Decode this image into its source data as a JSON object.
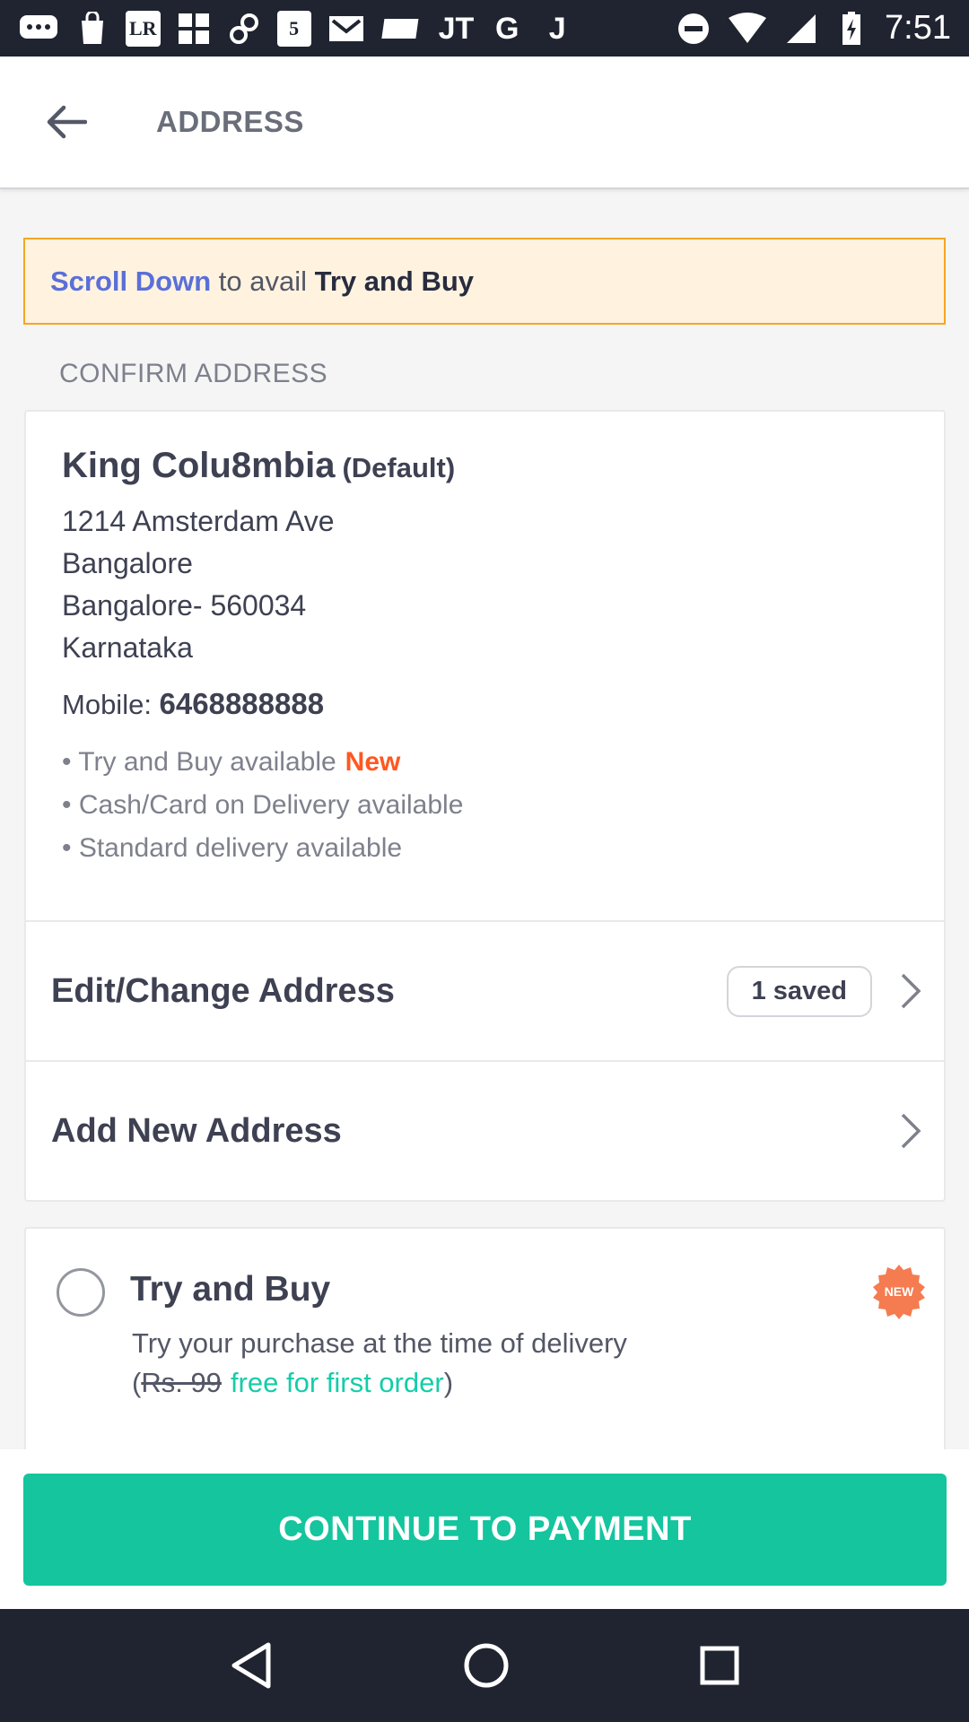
{
  "status_bar": {
    "icons": [
      "messages-icon",
      "shopping-bag-icon",
      "lr-icon",
      "grid-icon",
      "link-icon",
      "five-icon",
      "gmail-icon",
      "ticket-icon",
      "jt-icon",
      "google-icon",
      "j-icon"
    ],
    "lr_text": "LR",
    "five_text": "5",
    "g_text": "G",
    "j_text": "J",
    "jt_text": "JT",
    "time": "7:51"
  },
  "header": {
    "title": "ADDRESS"
  },
  "banner": {
    "link_text": "Scroll Down",
    "middle_text": " to avail ",
    "strong_text": "Try and Buy"
  },
  "section_label": "CONFIRM ADDRESS",
  "address": {
    "name": "King Colu8mbia",
    "default_tag": "(Default)",
    "lines": [
      "1214 Amsterdam Ave",
      "Bangalore",
      "Bangalore- 560034",
      "Karnataka"
    ],
    "mobile_label": "Mobile: ",
    "mobile_value": "6468888888",
    "features": [
      "• Try and Buy available",
      "• Cash/Card on Delivery available",
      "• Standard delivery available"
    ],
    "new_tag": "New"
  },
  "rows": {
    "edit_label": "Edit/Change Address",
    "saved_count": "1 saved",
    "add_label": "Add New Address"
  },
  "try_and_buy": {
    "title": "Try and Buy",
    "description": "Try your purchase at the time of delivery",
    "price_open": "(",
    "price_strike": "Rs. 99",
    "price_free": "free for first order",
    "price_close": ")",
    "badge": "NEW"
  },
  "continue_button": "CONTINUE TO PAYMENT",
  "colors": {
    "accent": "#14c59e",
    "link": "#5a6fd8",
    "new": "#ff5722",
    "banner_bg": "#fff3e0",
    "banner_border": "#f5a623"
  }
}
